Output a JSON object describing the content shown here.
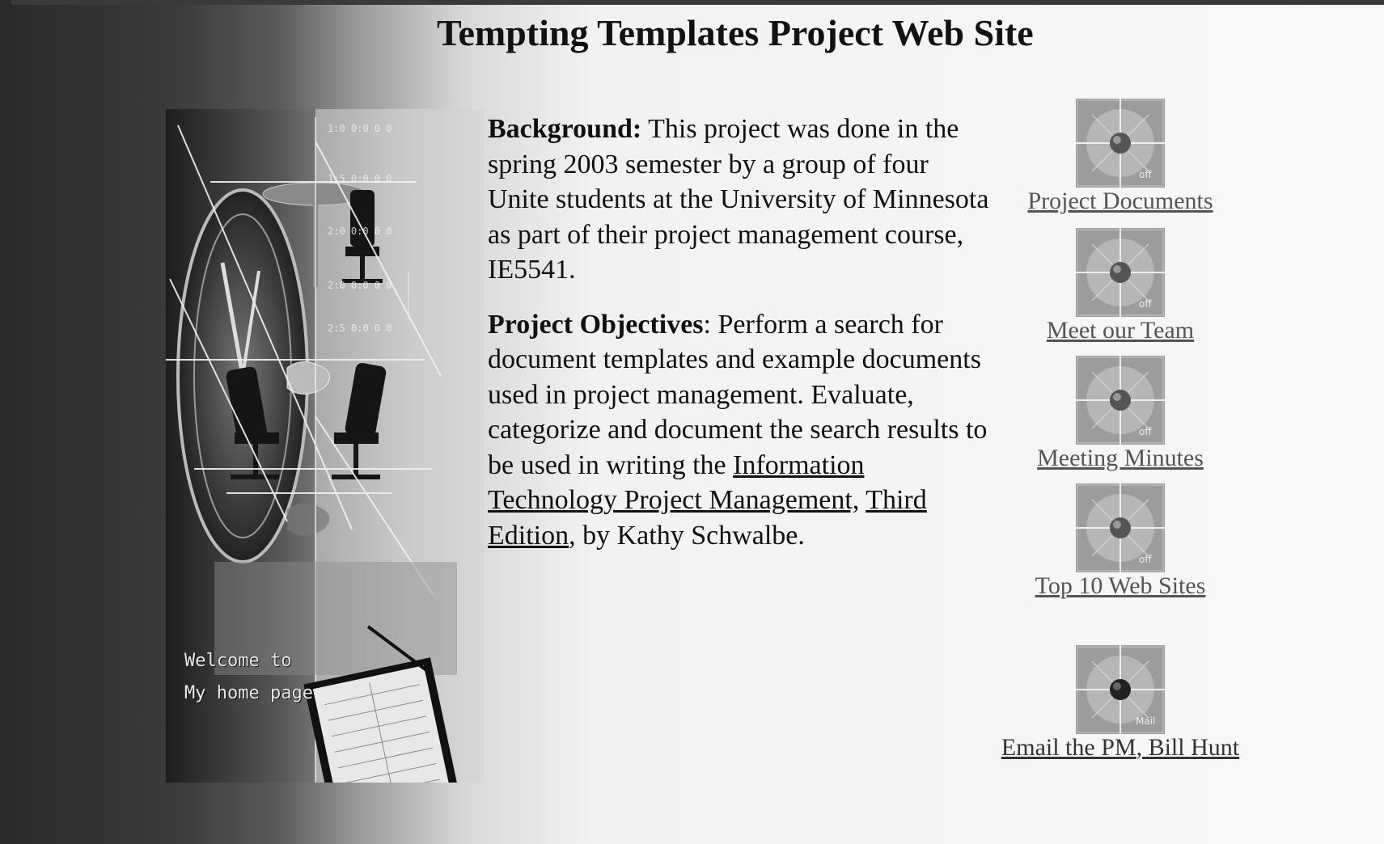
{
  "page": {
    "title": "Tempting Templates Project Web Site"
  },
  "collage": {
    "welcome_line1": "Welcome to",
    "welcome_line2": "My home page"
  },
  "content": {
    "background_heading": "Background:",
    "background_text": " This project was done in the spring 2003 semester by a group of four Unite students at the University of Minnesota as part of their project management course, IE5541.",
    "objectives_heading": "Project Objectives",
    "objectives_text": ": Perform a search for document templates and example documents used in project management.  Evaluate, categorize and document the search results to be used in writing the ",
    "book_link_1": "Information Technology Project Management,",
    "book_sep": " ",
    "book_link_2": "Third Edition",
    "objectives_tail": ", by Kathy Schwalbe."
  },
  "nav": {
    "items": [
      {
        "label": "Project Documents",
        "icon": "globe-icon"
      },
      {
        "label": "Meet our Team",
        "icon": "globe-icon"
      },
      {
        "label": "Meeting Minutes",
        "icon": "globe-icon"
      },
      {
        "label": "Top 10 Web Sites",
        "icon": "globe-icon"
      }
    ],
    "email": {
      "label_1": "Email the PM",
      "sep": ", ",
      "label_2": "Bill Hunt",
      "icon": "mail-globe-icon"
    }
  },
  "colors": {
    "text": "#111111",
    "link_grey": "#555555",
    "dark_border": "#2a2a2a"
  }
}
